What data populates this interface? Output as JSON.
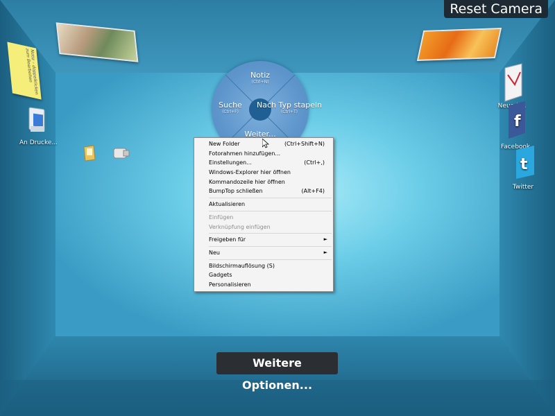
{
  "window": {
    "reset_camera": "Reset Camera"
  },
  "colors": {
    "room_floor": "#5fc2e3",
    "room_back": "#7fd4ee",
    "pie_fill": "#5e96cc",
    "menu_bg": "#f4f4f4",
    "tooltip_bg": "#2b2f33"
  },
  "desktop": {
    "sticky_note_text": "Notiz – doppelklicken zum Bearbeiten",
    "left_icons": [
      {
        "name": "printer-icon",
        "label": "An Drucke..."
      },
      {
        "name": "folder-icon",
        "label": ""
      },
      {
        "name": "usb-icon",
        "label": ""
      }
    ],
    "right_icons": [
      {
        "name": "mail-icon",
        "label": "Neue E..."
      },
      {
        "name": "facebook-icon",
        "label": "Facebook"
      },
      {
        "name": "twitter-icon",
        "label": "Twitter"
      }
    ]
  },
  "pie_menu": {
    "top": {
      "label": "Notiz",
      "hint": "(Ctrl+N)"
    },
    "left": {
      "label": "Suche",
      "hint": "(Ctrl+F)"
    },
    "right": {
      "label": "Nach Typ stapeln",
      "hint": "(Ctrl+T)"
    },
    "bottom": {
      "label": "Weiter..."
    }
  },
  "context_menu": {
    "groups": [
      [
        {
          "label": "New Folder",
          "shortcut": "(Ctrl+Shift+N)"
        },
        {
          "label": "Fotorahmen hinzufügen...",
          "shortcut": ""
        },
        {
          "label": "Einstellungen...",
          "shortcut": "(Ctrl+,)"
        },
        {
          "label": "Windows-Explorer hier öffnen",
          "shortcut": ""
        },
        {
          "label": "Kommandozeile hier öffnen",
          "shortcut": ""
        },
        {
          "label": "BumpTop schließen",
          "shortcut": "(Alt+F4)"
        }
      ],
      [
        {
          "label": "Aktualisieren",
          "shortcut": ""
        }
      ],
      [
        {
          "label": "Einfügen",
          "shortcut": "",
          "disabled": true
        },
        {
          "label": "Verknüpfung einfügen",
          "shortcut": "",
          "disabled": true
        }
      ],
      [
        {
          "label": "Freigeben für",
          "shortcut": "",
          "submenu": true
        }
      ],
      [
        {
          "label": "Neu",
          "shortcut": "",
          "submenu": true
        }
      ],
      [
        {
          "label": "Bildschirmauflösung (S)",
          "shortcut": ""
        },
        {
          "label": "Gadgets",
          "shortcut": ""
        },
        {
          "label": "Personalisieren",
          "shortcut": ""
        }
      ]
    ]
  },
  "tooltip": {
    "text": "Weitere Optionen..."
  }
}
